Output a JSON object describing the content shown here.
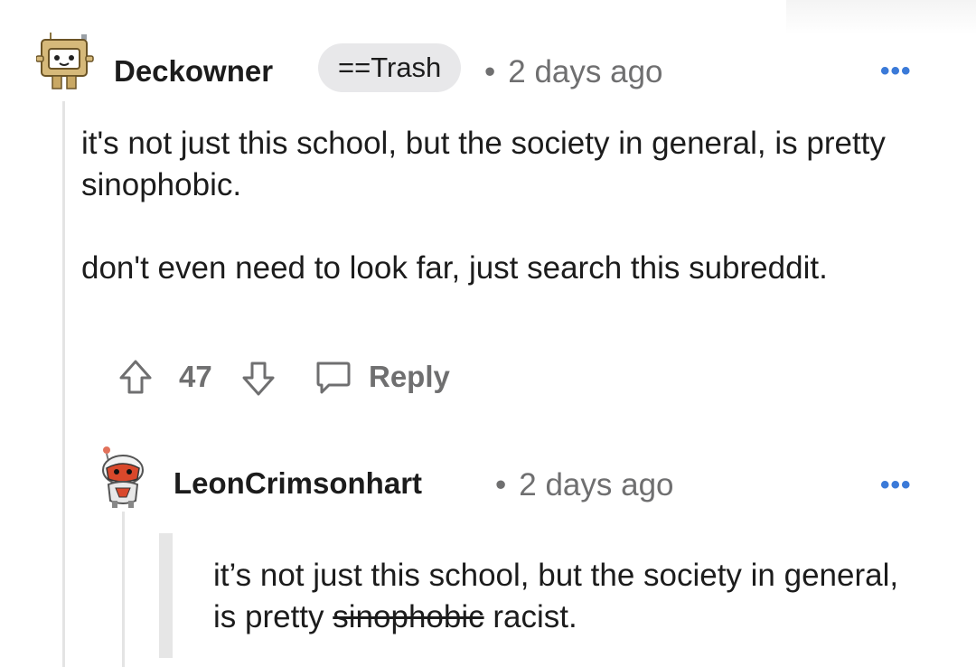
{
  "comment": {
    "username": "Deckowner",
    "flair": "==Trash",
    "separator": "•",
    "timestamp": "2 days ago",
    "more": "•••",
    "paragraphs": [
      "it's not just this school, but the society in general, is pretty sinophobic.",
      "don't even need to look far, just search this subreddit."
    ],
    "votes": "47",
    "reply_label": "Reply"
  },
  "reply": {
    "username": "LeonCrimsonhart",
    "separator": "•",
    "timestamp": "2 days ago",
    "more": "•••",
    "quote_prefix": "it’s not just this school, but the society in general, is pretty ",
    "quote_struck": "sinophobic",
    "quote_suffix": " racist."
  },
  "icons": {
    "upvote": "upvote-arrow-icon",
    "downvote": "downvote-arrow-icon",
    "reply": "speech-bubble-icon",
    "more": "more-dots-icon"
  },
  "colors": {
    "text": "#1c1c1c",
    "meta": "#6f6f70",
    "more": "#3b7ad8",
    "flair_bg": "#e8e8ea",
    "thread_line": "#e4e4e4"
  }
}
